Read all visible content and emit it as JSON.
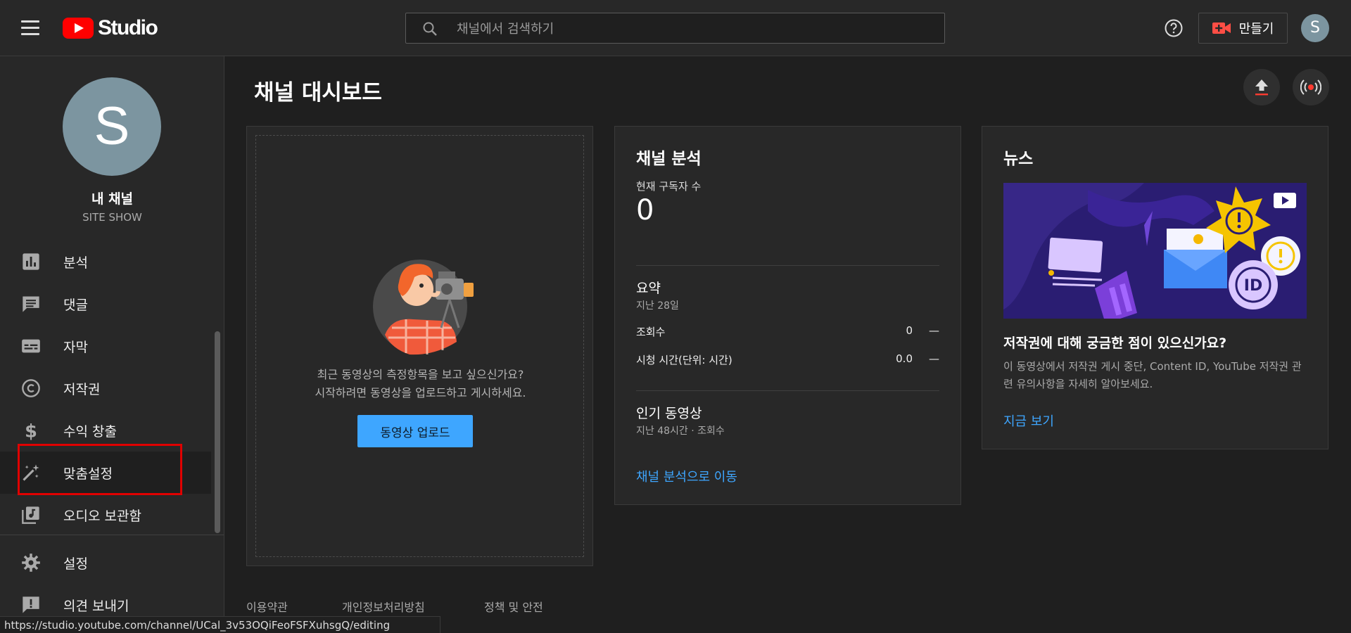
{
  "header": {
    "logo_text": "Studio",
    "search_placeholder": "채널에서 검색하기",
    "create_label": "만들기",
    "account_initial": "S"
  },
  "sidebar": {
    "channel_initial": "S",
    "channel_title": "내 채널",
    "channel_name": "SITE SHOW",
    "items": [
      {
        "label": "분석",
        "icon": "analytics-icon"
      },
      {
        "label": "댓글",
        "icon": "comments-icon"
      },
      {
        "label": "자막",
        "icon": "subtitles-icon"
      },
      {
        "label": "저작권",
        "icon": "copyright-icon"
      },
      {
        "label": "수익 창출",
        "icon": "dollar-icon"
      },
      {
        "label": "맞춤설정",
        "icon": "magic-wand-icon"
      },
      {
        "label": "오디오 보관함",
        "icon": "audio-library-icon"
      }
    ],
    "bottom_items": [
      {
        "label": "설정",
        "icon": "gear-icon"
      },
      {
        "label": "의견 보내기",
        "icon": "feedback-icon"
      }
    ]
  },
  "main": {
    "title": "채널 대시보드",
    "upload_card": {
      "line1": "최근 동영상의 측정항목을 보고 싶으신가요?",
      "line2": "시작하려면 동영상을 업로드하고 게시하세요.",
      "button": "동영상 업로드"
    },
    "analytics_card": {
      "title": "채널 분석",
      "subscribers_label": "현재 구독자 수",
      "subscribers_value": "0",
      "summary_title": "요약",
      "summary_period": "지난 28일",
      "metrics": [
        {
          "label": "조회수",
          "value": "0",
          "delta": "—"
        },
        {
          "label": "시청 시간(단위: 시간)",
          "value": "0.0",
          "delta": "—"
        }
      ],
      "top_videos_title": "인기 동영상",
      "top_videos_period": "지난 48시간 · 조회수",
      "link": "채널 분석으로 이동"
    },
    "news_card": {
      "title": "뉴스",
      "headline": "저작권에 대해 궁금한 점이 있으신가요?",
      "body": "이 동영상에서 저작권 게시 중단, Content ID, YouTube 저작권 관련 유의사항을 자세히 알아보세요.",
      "link": "지금 보기"
    }
  },
  "footer": {
    "links": [
      "이용약관",
      "개인정보처리방침",
      "정책 및 안전"
    ]
  },
  "status_url": "https://studio.youtube.com/channel/UCal_3v53OQiFeoFSFXuhsgQ/editing",
  "colors": {
    "accent_blue": "#3ea6ff",
    "youtube_red": "#ff0000",
    "highlight_box": "#e00000"
  }
}
